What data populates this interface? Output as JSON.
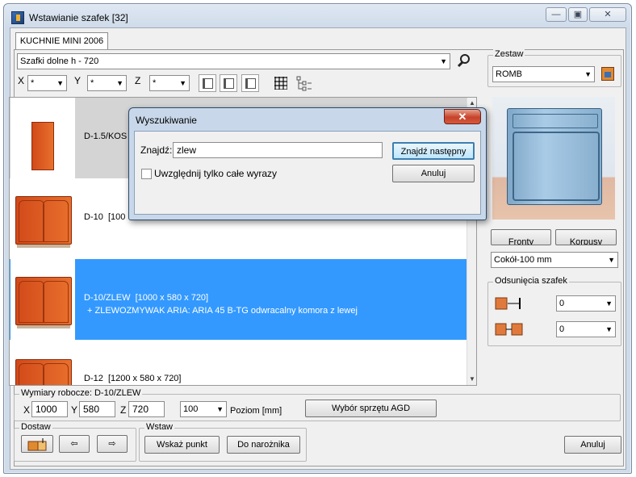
{
  "window": {
    "title": "Wstawianie szafek [32]",
    "controls": [
      "minimize-icon",
      "maximize-icon",
      "close-icon"
    ]
  },
  "tabs": [
    {
      "label": "KUCHNIE MINI 2006"
    }
  ],
  "catalog": {
    "selected": "Szafki dolne h - 720"
  },
  "filters": {
    "x_label": "X",
    "x_value": "*",
    "y_label": "Y",
    "y_value": "*",
    "z_label": "Z",
    "z_value": "*"
  },
  "items": [
    {
      "name": "D-1.5/KOS",
      "dims": "",
      "extra": ""
    },
    {
      "name": "D-10",
      "dims": "[100",
      "extra": ""
    },
    {
      "name": "D-10/ZLEW",
      "dims": "[1000 x 580 x 720]",
      "extra": "+ ZLEWOZMYWAK ARIA: ARIA 45 B-TG odwracalny komora z lewej"
    },
    {
      "name": "D-12",
      "dims": "[1200 x 580 x 720]",
      "extra": ""
    }
  ],
  "zestaw": {
    "label": "Zestaw",
    "selected": "ROMB"
  },
  "preview_buttons": {
    "front": "Fronty",
    "bodies": "Korpusy"
  },
  "plinth": {
    "selected": "Cokół-100 mm"
  },
  "offsets": {
    "label": "Odsunięcia szafek",
    "left_value": "0",
    "right_value": "0"
  },
  "dimensions": {
    "label": "Wymiary robocze: D-10/ZLEW",
    "x_label": "X",
    "x_value": "1000",
    "y_label": "Y",
    "y_value": "580",
    "z_label": "Z",
    "z_value": "720",
    "level_value": "100",
    "level_label": "Poziom [mm]",
    "agd_button": "Wybór sprzętu AGD"
  },
  "dostaw": {
    "label": "Dostaw"
  },
  "wstaw": {
    "label": "Wstaw",
    "point_button": "Wskaż punkt",
    "corner_button": "Do narożnika"
  },
  "cancel_button": "Anuluj",
  "search_dialog": {
    "title": "Wyszukiwanie",
    "find_label": "Znajdź:",
    "find_value": "zlew",
    "find_next_button": "Znajdź następny",
    "whole_words_label": "Uwzględnij tylko całe wyrazy",
    "cancel_button": "Anuluj"
  }
}
